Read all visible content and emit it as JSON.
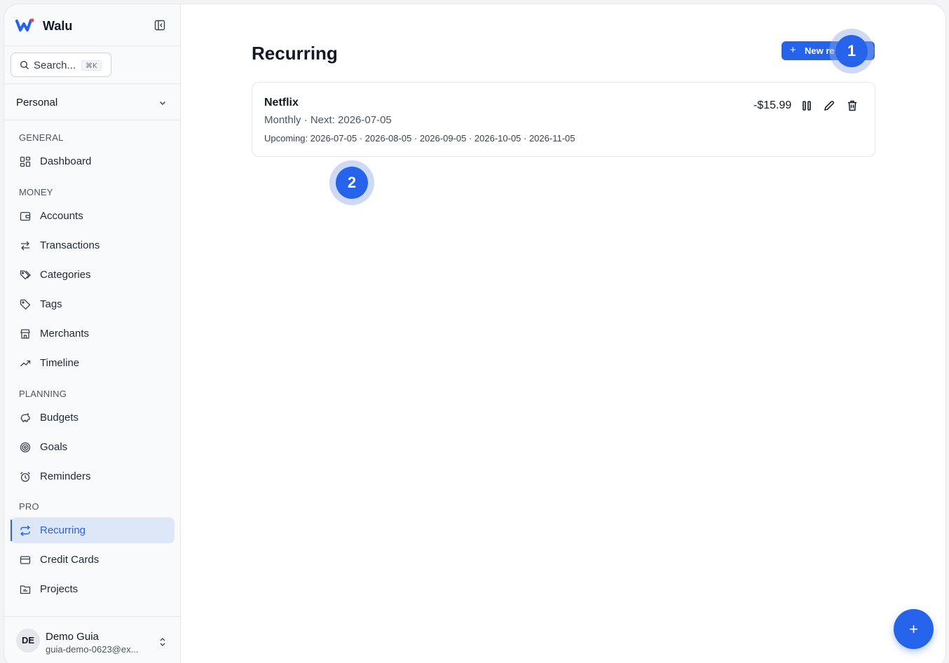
{
  "app": {
    "name": "Walu"
  },
  "search": {
    "placeholder": "Search...",
    "shortcut": "⌘K"
  },
  "workspace": {
    "selected": "Personal"
  },
  "sidebar": {
    "sections": [
      {
        "title": "GENERAL",
        "items": [
          {
            "label": "Dashboard",
            "icon": "dashboard-icon"
          }
        ]
      },
      {
        "title": "MONEY",
        "items": [
          {
            "label": "Accounts",
            "icon": "wallet-icon"
          },
          {
            "label": "Transactions",
            "icon": "arrows-left-right-icon"
          },
          {
            "label": "Categories",
            "icon": "tags-icon"
          },
          {
            "label": "Tags",
            "icon": "tag-icon"
          },
          {
            "label": "Merchants",
            "icon": "store-icon"
          },
          {
            "label": "Timeline",
            "icon": "trend-up-icon"
          }
        ]
      },
      {
        "title": "PLANNING",
        "items": [
          {
            "label": "Budgets",
            "icon": "piggy-bank-icon"
          },
          {
            "label": "Goals",
            "icon": "target-icon"
          },
          {
            "label": "Reminders",
            "icon": "alarm-clock-icon"
          }
        ]
      },
      {
        "title": "PRO",
        "items": [
          {
            "label": "Recurring",
            "icon": "repeat-icon",
            "active": true
          },
          {
            "label": "Credit Cards",
            "icon": "credit-card-icon"
          },
          {
            "label": "Projects",
            "icon": "folder-icon"
          }
        ]
      }
    ]
  },
  "user": {
    "initials": "DE",
    "name": "Demo Guia",
    "email": "guia-demo-0623@ex..."
  },
  "main": {
    "title": "Recurring",
    "new_button": "New re",
    "new_button_icon": "+",
    "recurring_items": [
      {
        "name": "Netflix",
        "schedule": "Monthly · Next: 2026-07-05",
        "upcoming": "Upcoming: 2026-07-05 · 2026-08-05 · 2026-09-05 · 2026-10-05 · 2026-11-05",
        "amount": "-$15.99"
      }
    ]
  },
  "markers": [
    "1",
    "2"
  ],
  "fab": {
    "icon": "+"
  },
  "colors": {
    "accent": "#2563eb",
    "active_bg": "#dde7f7"
  }
}
